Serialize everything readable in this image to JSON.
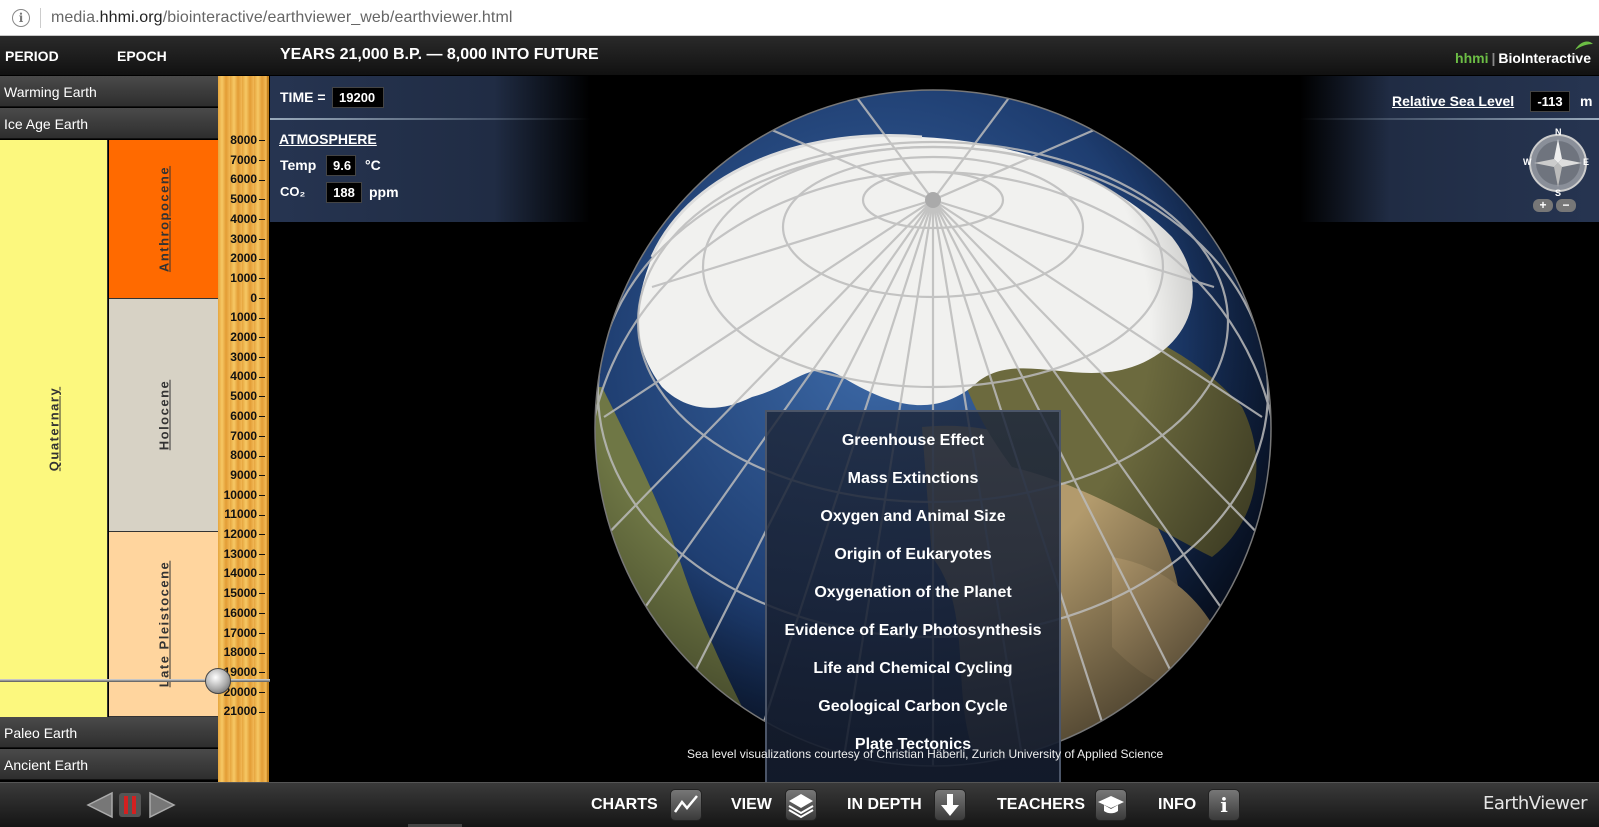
{
  "browser": {
    "url_prefix": "media.",
    "url_domain": "hhmi.org",
    "url_path": "/biointeractive/earthviewer_web/earthviewer.html"
  },
  "header": {
    "period_label": "PERIOD",
    "epoch_label": "EPOCH",
    "title": "YEARS 21,000 B.P. — 8,000 INTO FUTURE",
    "logo_hhmi": "hhmi",
    "logo_sep": "|",
    "logo_bio": "BioInteractive"
  },
  "nav": {
    "warming_earth": "Warming Earth",
    "ice_age_earth": "Ice Age Earth",
    "paleo_earth": "Paleo Earth",
    "ancient_earth": "Ancient Earth"
  },
  "timeline": {
    "period": "Quaternary",
    "epochs": [
      {
        "name": "Anthropocene",
        "color": "#ff6a00"
      },
      {
        "name": "Holocene",
        "color": "#d7d2c5"
      },
      {
        "name": "Late Pleistocene",
        "color": "#ffd59e"
      }
    ],
    "ticks_future": [
      "8000",
      "7000",
      "6000",
      "5000",
      "4000",
      "3000",
      "2000",
      "1000",
      "0"
    ],
    "ticks_past": [
      "1000",
      "2000",
      "3000",
      "4000",
      "5000",
      "6000",
      "7000",
      "8000",
      "9000",
      "10000",
      "11000",
      "12000",
      "13000",
      "14000",
      "15000",
      "16000",
      "17000",
      "18000",
      "19000",
      "20000",
      "21000"
    ],
    "current_year_bp": 19200
  },
  "atmosphere": {
    "time_label": "TIME =",
    "time_value": "19200",
    "heading": "ATMOSPHERE",
    "temp_label": "Temp",
    "temp_value": "9.6",
    "temp_unit": "°C",
    "co2_label": "CO₂",
    "co2_value": "188",
    "co2_unit": "ppm"
  },
  "sea_level": {
    "label": "Relative Sea Level",
    "value": "-113",
    "unit": "m"
  },
  "compass": {
    "n": "N",
    "s": "S",
    "e": "E",
    "w": "W",
    "zoom_in": "+",
    "zoom_out": "−"
  },
  "in_depth_menu": [
    "Greenhouse Effect",
    "Mass Extinctions",
    "Oxygen and Animal Size",
    "Origin of Eukaryotes",
    "Oxygenation of the Planet",
    "Evidence of Early Photosynthesis",
    "Life and Chemical Cycling",
    "Geological Carbon Cycle",
    "Plate Tectonics"
  ],
  "credit": "Sea level visualizations courtesy of Christian Häberli, Zurich University of Applied Science",
  "toolbar": {
    "charts": "CHARTS",
    "view": "VIEW",
    "in_depth": "IN DEPTH",
    "teachers": "TEACHERS",
    "info": "INFO",
    "info_glyph": "i",
    "brand": "EarthViewer"
  }
}
